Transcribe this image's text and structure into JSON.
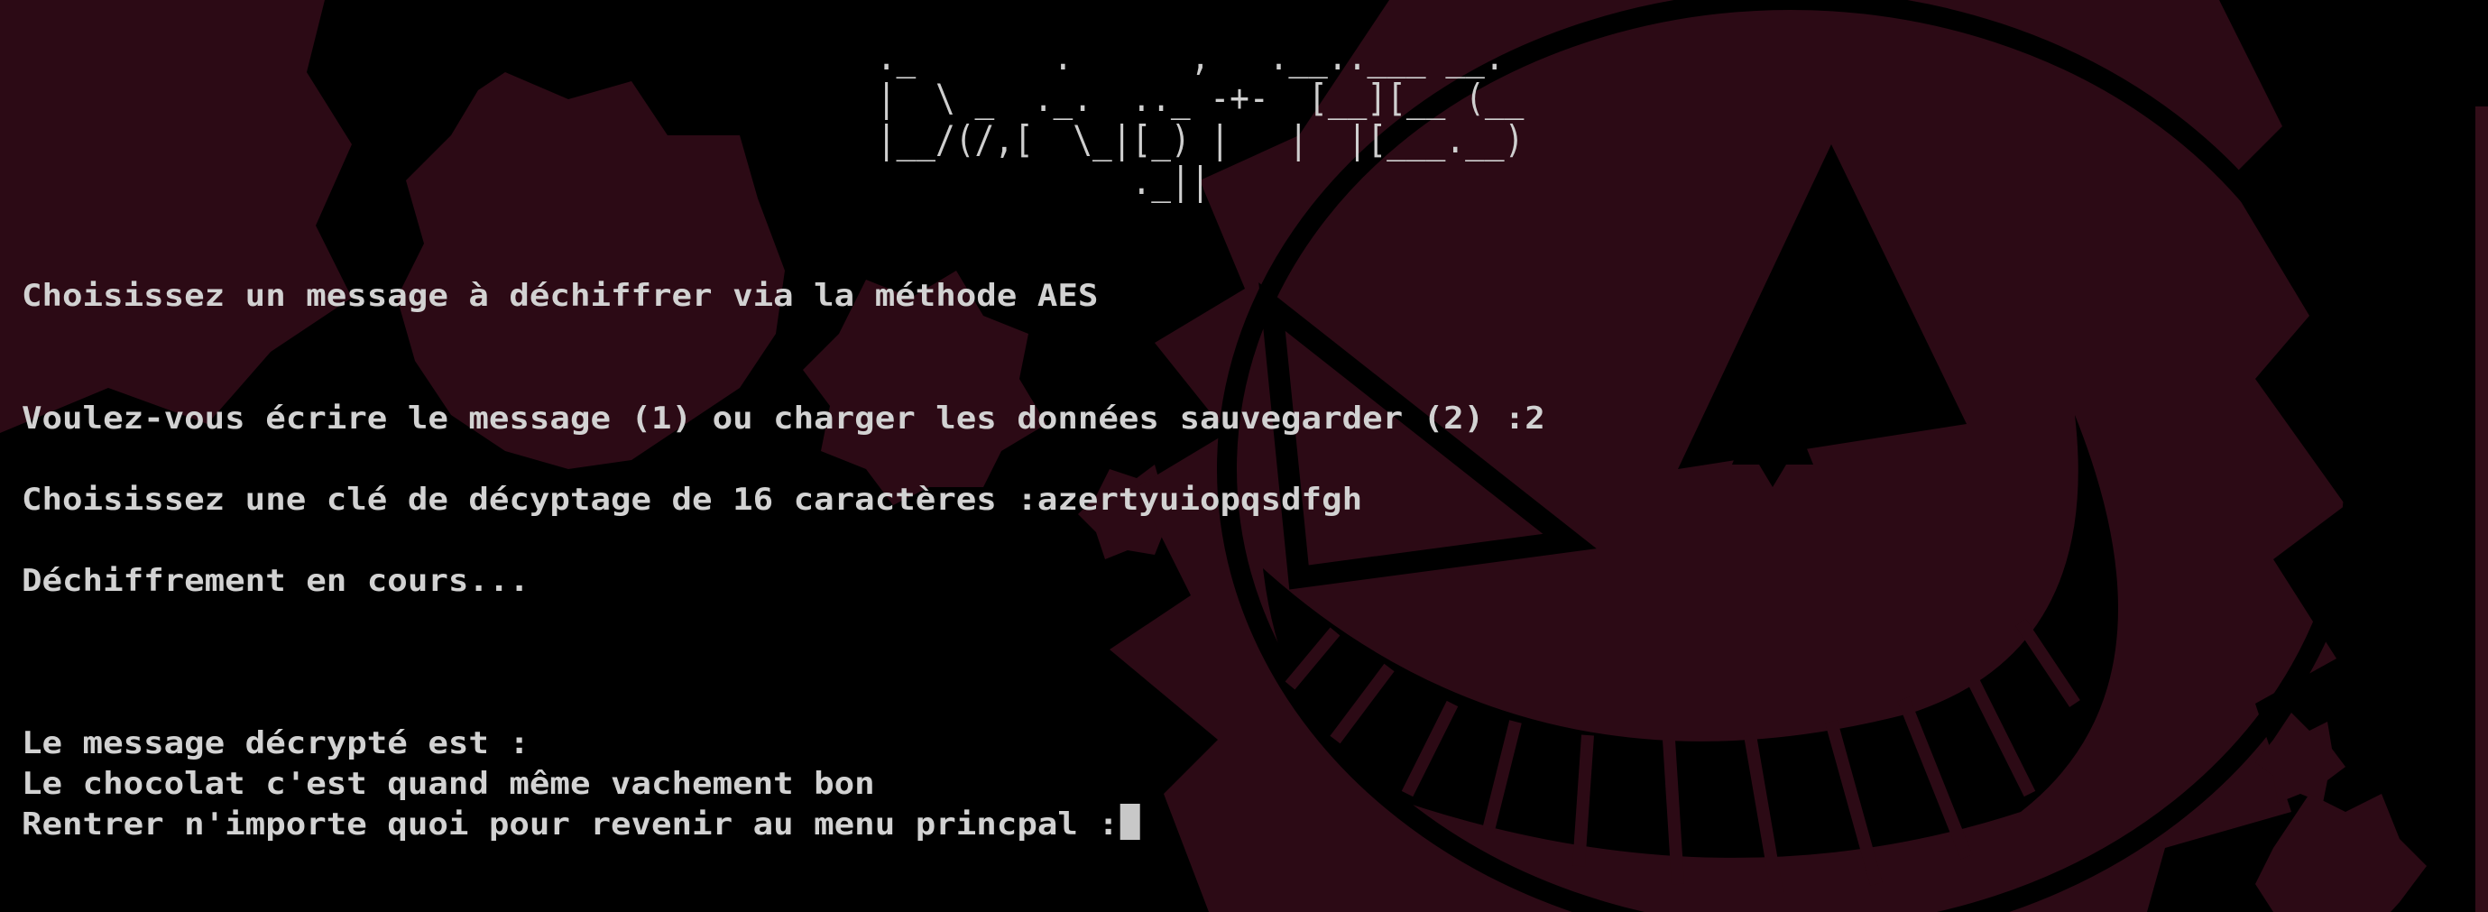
{
  "banner": {
    "ascii_art": " ._       .      ,   .__..___ __.\n |  \\ _  ._.  .._ -+-  [__][__ (__\n |__/(/,[  \\_|[_) |   |  |[___.__)\n              ._||"
  },
  "console": {
    "lines": [
      "Choisissez un message à déchiffrer via la méthode AES",
      "Voulez-vous écrire le message (1) ou charger les données sauvegarder (2) :2",
      "Choisissez une clé de décyptage de 16 caractères :azertyuiopqsdfgh",
      "Déchiffrement en cours...",
      "Le message décrypté est :",
      "Le chocolat c'est quand même vachement bon",
      "Rentrer n'importe quoi pour revenir au menu princpal :"
    ]
  },
  "colors": {
    "background": "#000000",
    "text": "#d2d2d2",
    "wallpaper": "#2e0b16"
  },
  "icons": {
    "wallpaper": "grinning-ghost-wallpaper-icon",
    "cursor": "block-cursor-icon"
  }
}
